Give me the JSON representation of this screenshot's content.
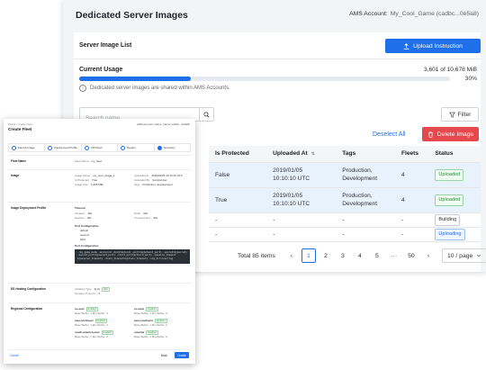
{
  "images_page": {
    "title": "Dedicated Server Images",
    "ams_label": "AMS Account:",
    "ams_value": "My_Cool_Game (cadbc...0e5a8)",
    "card_title": "Server Image List",
    "upload_button": "Upload Instruction",
    "usage_label": "Current Usage",
    "usage_value": "3,601 of 10,678 MiB",
    "usage_percent_label": "30%",
    "usage_fraction": 0.3,
    "usage_note": "Dedicated server images are shared within AMS Accounts.",
    "search_placeholder": "Search name",
    "filter_button": "Filter",
    "deselect_label": "Deselect All",
    "delete_button": "Delete Image",
    "table": {
      "headers": [
        "Is Protected",
        "Uploaded At",
        "Tags",
        "Fleets",
        "Status"
      ],
      "rows": [
        {
          "protected": "False",
          "uploaded_line1": "2019/01/05",
          "uploaded_line2": "10:10:10 UTC",
          "tags_line1": "Production,",
          "tags_line2": "Development",
          "fleets": "4",
          "status": "Uploaded"
        },
        {
          "protected": "True",
          "uploaded_line1": "2019/01/05",
          "uploaded_line2": "10:10:10 UTC",
          "tags_line1": "Production,",
          "tags_line2": "Development",
          "fleets": "4",
          "status": "Uploaded"
        },
        {
          "protected": "-",
          "uploaded_line1": "-",
          "uploaded_line2": "",
          "tags_line1": "-",
          "tags_line2": "",
          "fleets": "-",
          "status": "Building"
        },
        {
          "protected": "-",
          "uploaded_line1": "-",
          "uploaded_line2": "",
          "tags_line1": "-",
          "tags_line2": "",
          "fleets": "-",
          "status": "Uploading"
        }
      ]
    },
    "pagination": {
      "total": "Total 85 items",
      "prev": "‹",
      "pages": [
        "1",
        "2",
        "3",
        "4",
        "5"
      ],
      "ellipsis": "···",
      "last": "50",
      "next": "›",
      "per_page": "10 / page"
    }
  },
  "fleet_form": {
    "breadcrumb": "Fleets / Create Fleet",
    "title": "Create Fleet",
    "account": "AMS Account: Name_Name (cadbc...0e5a8)",
    "steps": [
      "Fleet & Image",
      "Deployment Profile",
      "VM Sizes",
      "Region",
      "Summary"
    ],
    "sections": {
      "fleet_name": {
        "heading": "Fleet Name",
        "key": "Fleet Name",
        "value": "my_fleet"
      },
      "image": {
        "heading": "Image",
        "items": [
          {
            "k": "Image Name",
            "v": "my_cool_image_1"
          },
          {
            "k": "Is Protected",
            "v": "True"
          },
          {
            "k": "Image Size",
            "v": "1,065 MiB"
          },
          {
            "k": "Uploaded At",
            "v": "2019/01/05 10:10:10 UTC"
          },
          {
            "k": "Uploaded By",
            "v": "ServiceUser"
          },
          {
            "k": "Tags",
            "v": "Production, development"
          }
        ]
      },
      "deployment": {
        "heading": "Image Deployment Profile",
        "timeout_heading": "Timeout",
        "items": [
          {
            "k": "Creation",
            "v": "30s"
          },
          {
            "k": "Session",
            "v": "30s"
          },
          {
            "k": "Drain",
            "v": "30s"
          },
          {
            "k": "Unresponsive",
            "v": "30s"
          }
        ],
        "port_heading": "Port Configuration",
        "ports": [
          "default",
          "second",
          "third"
        ],
        "cmd_heading": "Port Configuration",
        "cmd": "./my_game_mode -env=prod -dsid=${dsid} -port=${default_port} -secret=${secret}\n-second_port=${second_port} -third_port=${third_port} -session_timeout\n${session_timeout} -drain_timeout=${drain_timeout} -log_dir=/var/log"
      },
      "hosting": {
        "heading": "DS Hosting Configuration",
        "items": [
          {
            "k": "Instance Type",
            "v": "fg.2s"
          },
          {
            "k": "Number of server",
            "v": "3"
          }
        ],
        "badge": "Edit"
      },
      "regional": {
        "heading": "Regional Configuration",
        "regions": [
          {
            "name": "us-east",
            "tag": "Enabled",
            "line": "Base Buffer: 1 Min Buffer: 0"
          },
          {
            "name": "us-west",
            "tag": "Enabled",
            "line": "Base Buffer: 1 Min Buffer: 0"
          },
          {
            "name": "asia-northeast",
            "tag": "Enabled",
            "line": "Base Buffer: 1 Min Buffer: 0"
          },
          {
            "name": "asia-southeast",
            "tag": "Enabled",
            "line": "Base Buffer: 1 Min Buffer: 0"
          },
          {
            "name": "south-america-east",
            "tag": "Enabled",
            "line": "Base Buffer: 1 Min Buffer: 0"
          },
          {
            "name": "oceania",
            "tag": "Enabled",
            "line": "Base Buffer: 1 Min Buffer: 0"
          }
        ]
      }
    },
    "cancel": "Cancel",
    "back": "Back",
    "create": "Create"
  },
  "colors": {
    "primary": "#1f6feb",
    "danger": "#e5484d",
    "selected_row": "#e8f2fd",
    "success": "#2e8b3a"
  },
  "icons": {
    "upload": "upload-icon",
    "info": "info-icon",
    "search": "search-icon",
    "filter": "filter-icon",
    "delete": "trash-icon",
    "dropdown": "chevron-down-icon"
  }
}
